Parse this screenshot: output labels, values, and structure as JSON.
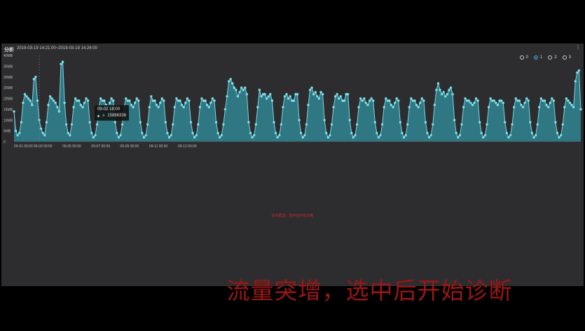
{
  "header": {
    "title": "分析",
    "time_range": "2019-03-19 14:21:00~2019-03-19 14:26:00"
  },
  "radio_options": [
    "0",
    "1",
    "2",
    "3"
  ],
  "selected_radio": "1",
  "tooltip": {
    "time": "09-02 18:00",
    "series": "a",
    "value": "15886336"
  },
  "hint_text": "请先框选，选中后开始诊断",
  "subtitle": "流量突增，选中后开始诊断",
  "colors": {
    "fill": "#2e7783",
    "line": "#7ed6e4",
    "point": "#7ee1ea",
    "hint": "#cc2a2a",
    "subtitle": "#9c1616"
  },
  "chart_data": {
    "type": "area",
    "x_ticks": [
      "09-01 00:00",
      "09-03 00:00",
      "09-05 00:00",
      "09-07 00:00",
      "09-09 00:00",
      "09-11 00:00",
      "09-13 00:00"
    ],
    "y_ticks": [
      "0",
      "5MB",
      "10MB",
      "15MB",
      "20MB",
      "25MB",
      "30MB",
      "35MB",
      "40MB"
    ],
    "ylim": [
      0,
      40
    ],
    "x_start": "09-01 00:00",
    "x_step_hours": 3,
    "y_unit": "MB",
    "values": [
      14,
      5,
      3,
      4,
      9,
      18,
      22,
      21,
      20,
      19,
      17,
      29,
      30,
      19,
      10,
      6,
      4,
      3,
      9,
      17,
      21,
      20,
      19,
      18,
      16,
      14,
      36,
      37,
      18,
      8,
      4,
      3,
      8,
      16,
      20,
      19,
      19,
      17,
      16,
      18,
      20,
      19,
      9,
      4,
      2,
      3,
      8,
      16,
      20,
      19,
      19,
      17,
      16,
      18,
      20,
      19,
      9,
      4,
      2,
      3,
      8,
      16,
      20,
      19,
      19,
      17,
      16,
      18,
      20,
      19,
      9,
      4,
      2,
      3,
      8,
      16,
      21,
      19,
      19,
      17,
      16,
      18,
      20,
      19,
      9,
      4,
      2,
      3,
      8,
      16,
      20,
      19,
      19,
      17,
      16,
      18,
      20,
      19,
      9,
      4,
      2,
      3,
      8,
      16,
      20,
      19,
      19,
      17,
      16,
      18,
      20,
      19,
      9,
      4,
      2,
      3,
      8,
      15,
      21,
      28,
      29,
      27,
      25,
      24,
      21,
      23,
      25,
      24,
      25,
      22,
      9,
      4,
      2,
      3,
      8,
      16,
      24,
      21,
      22,
      22,
      20,
      21,
      22,
      19,
      9,
      4,
      2,
      3,
      8,
      16,
      21,
      22,
      20,
      21,
      19,
      19,
      22,
      22,
      10,
      4,
      2,
      3,
      8,
      17,
      24,
      25,
      22,
      23,
      21,
      20,
      23,
      22,
      10,
      4,
      2,
      3,
      8,
      16,
      21,
      22,
      20,
      21,
      19,
      19,
      22,
      22,
      10,
      4,
      2,
      3,
      8,
      16,
      20,
      19,
      20,
      18,
      17,
      19,
      20,
      19,
      9,
      4,
      2,
      3,
      8,
      16,
      20,
      19,
      19,
      17,
      16,
      18,
      20,
      19,
      9,
      4,
      2,
      3,
      8,
      16,
      20,
      19,
      19,
      17,
      16,
      18,
      20,
      19,
      9,
      4,
      2,
      3,
      8,
      17,
      24,
      27,
      24,
      22,
      23,
      21,
      22,
      24,
      25,
      22,
      10,
      4,
      2,
      3,
      8,
      16,
      20,
      19,
      19,
      18,
      17,
      18,
      20,
      19,
      9,
      4,
      2,
      3,
      8,
      16,
      20,
      19,
      19,
      18,
      17,
      19,
      19,
      18,
      9,
      4,
      2,
      3,
      8,
      16,
      20,
      19,
      19,
      17,
      16,
      18,
      20,
      19,
      9,
      4,
      2,
      3,
      8,
      16,
      20,
      19,
      19,
      17,
      16,
      18,
      20,
      19,
      9,
      4,
      2,
      3,
      8,
      16,
      20,
      19,
      18,
      17,
      16,
      28,
      32,
      33,
      15
    ]
  }
}
